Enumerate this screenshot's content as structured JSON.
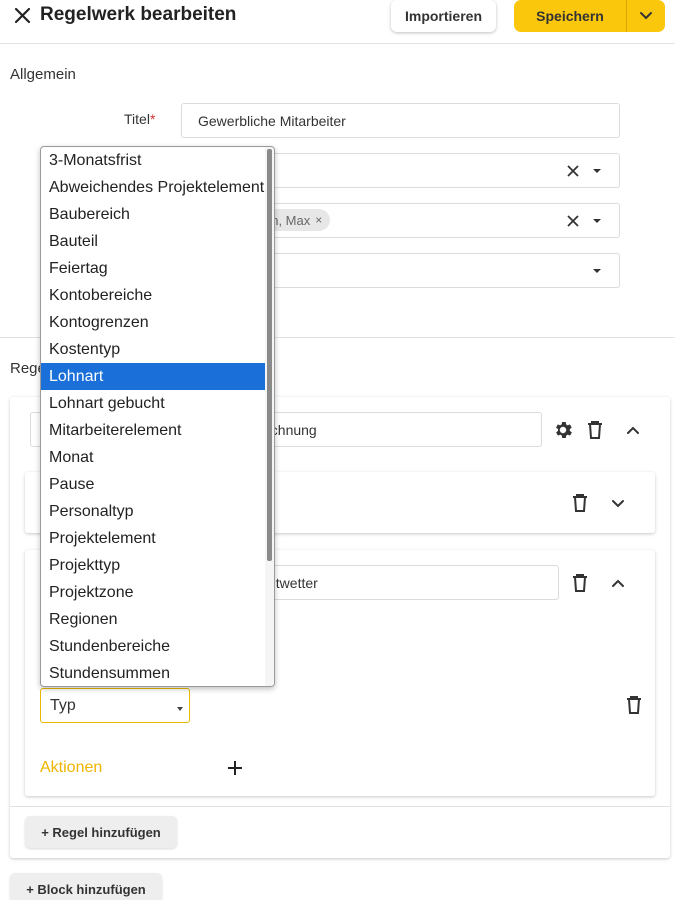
{
  "header": {
    "title": "Regelwerk bearbeiten",
    "import_label": "Importieren",
    "save_label": "Speichern"
  },
  "general": {
    "section_title": "Allgemein",
    "title_label": "Titel",
    "title_required_mark": "*",
    "title_value": "Gewerbliche Mitarbeiter",
    "chip_label_partial": "nn, Max",
    "chip_remove": "×"
  },
  "rules": {
    "section_title_partial": "Rege",
    "rule_name_partial": "echnung",
    "condition_value_partial": "chtwetter",
    "type_select_value": "Typ",
    "actions_label": "Aktionen",
    "add_rule_label": "+ Regel hinzufügen",
    "add_block_label": "+ Block hinzufügen"
  },
  "dropdown": {
    "options": [
      "3-Monatsfrist",
      "Abweichendes Projektelement",
      "Baubereich",
      "Bauteil",
      "Feiertag",
      "Kontobereiche",
      "Kontogrenzen",
      "Kostentyp",
      "Lohnart",
      "Lohnart gebucht",
      "Mitarbeiterelement",
      "Monat",
      "Pause",
      "Personaltyp",
      "Projektelement",
      "Projekttyp",
      "Projektzone",
      "Regionen",
      "Stundenbereiche",
      "Stundensummen"
    ],
    "selected": "Lohnart"
  },
  "colors": {
    "accent": "#fbc70c",
    "selection": "#1a6fd8",
    "required": "#d32f2f",
    "actions_text": "#f0b400"
  }
}
